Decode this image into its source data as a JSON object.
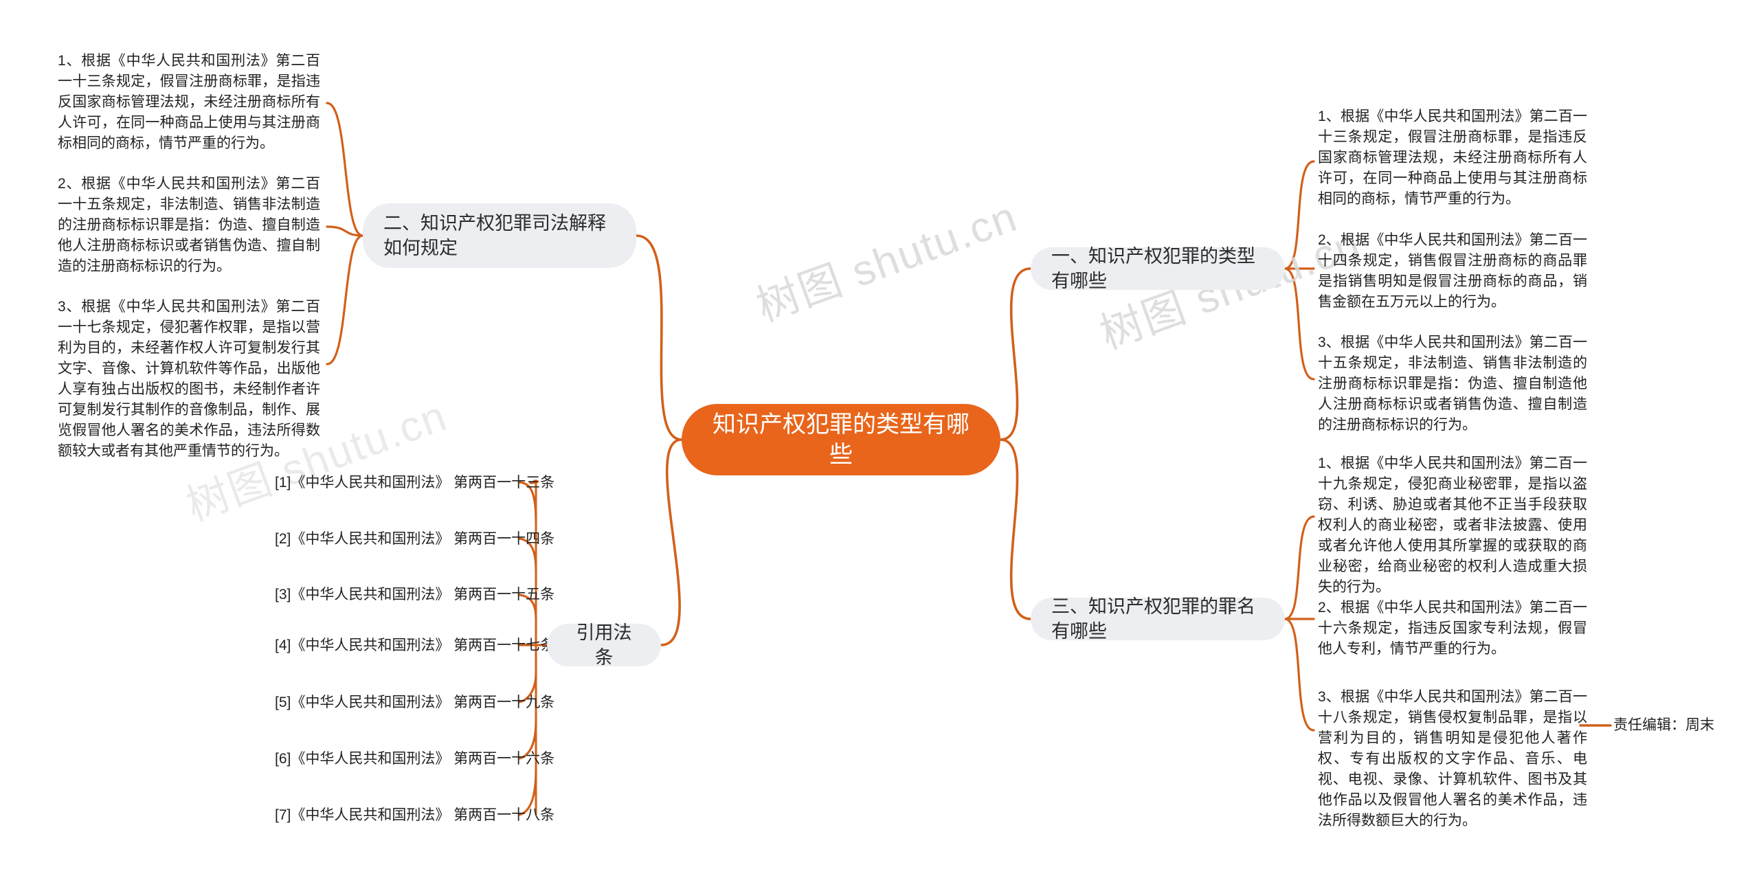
{
  "center": {
    "title": "知识产权犯罪的类型有哪些",
    "color": "#E8651B"
  },
  "branches": {
    "type_label": "一、知识产权犯罪的类型有哪些",
    "charge_label": "三、知识产权犯罪的罪名有哪些",
    "judicial_label": "二、知识产权犯罪司法解释如何规定",
    "cite_label": "引用法条"
  },
  "judicial_items": [
    "1、根据《中华人民共和国刑法》第二百一十三条规定，假冒注册商标罪，是指违反国家商标管理法规，未经注册商标所有人许可，在同一种商品上使用与其注册商标相同的商标，情节严重的行为。",
    "2、根据《中华人民共和国刑法》第二百一十五条规定，非法制造、销售非法制造的注册商标标识罪是指：伪造、擅自制造他人注册商标标识或者销售伪造、擅自制造的注册商标标识的行为。",
    "3、根据《中华人民共和国刑法》第二百一十七条规定，侵犯著作权罪，是指以营利为目的，未经著作权人许可复制发行其文字、音像、计算机软件等作品，出版他人享有独占出版权的图书，未经制作者许可复制发行其制作的音像制品，制作、展览假冒他人署名的美术作品，违法所得数额较大或者有其他严重情节的行为。"
  ],
  "type_items": [
    "1、根据《中华人民共和国刑法》第二百一十三条规定，假冒注册商标罪，是指违反国家商标管理法规，未经注册商标所有人许可，在同一种商品上使用与其注册商标相同的商标，情节严重的行为。",
    "2、根据《中华人民共和国刑法》第二百一十四条规定，销售假冒注册商标的商品罪是指销售明知是假冒注册商标的商品，销售金额在五万元以上的行为。",
    "3、根据《中华人民共和国刑法》第二百一十五条规定，非法制造、销售非法制造的注册商标标识罪是指：伪造、擅自制造他人注册商标标识或者销售伪造、擅自制造的注册商标标识的行为。"
  ],
  "charge_items": [
    "1、根据《中华人民共和国刑法》第二百一十九条规定，侵犯商业秘密罪，是指以盗窃、利诱、胁迫或者其他不正当手段获取权利人的商业秘密，或者非法披露、使用或者允许他人使用其所掌握的或获取的商业秘密，给商业秘密的权利人造成重大损失的行为。",
    "2、根据《中华人民共和国刑法》第二百一十六条规定，指违反国家专利法规，假冒他人专利，情节严重的行为。",
    "3、根据《中华人民共和国刑法》第二百一十八条规定，销售侵权复制品罪，是指以营利为目的，销售明知是侵犯他人著作权、专有出版权的文字作品、音乐、电视、电视、录像、计算机软件、图书及其他作品以及假冒他人署名的美术作品，违法所得数额巨大的行为。"
  ],
  "citations": [
    "[1]《中华人民共和国刑法》 第两百一十三条",
    "[2]《中华人民共和国刑法》 第两百一十四条",
    "[3]《中华人民共和国刑法》 第两百一十五条",
    "[4]《中华人民共和国刑法》 第两百一十七条",
    "[5]《中华人民共和国刑法》 第两百一十九条",
    "[6]《中华人民共和国刑法》 第两百一十六条",
    "[7]《中华人民共和国刑法》 第两百一十八条"
  ],
  "editor_credit": "责任编辑：周末",
  "watermark": "树图 shutu.cn",
  "colors": {
    "accent": "#E8651B",
    "link": "#D2601A",
    "pill_bg": "#eceef2",
    "text": "#222222"
  }
}
